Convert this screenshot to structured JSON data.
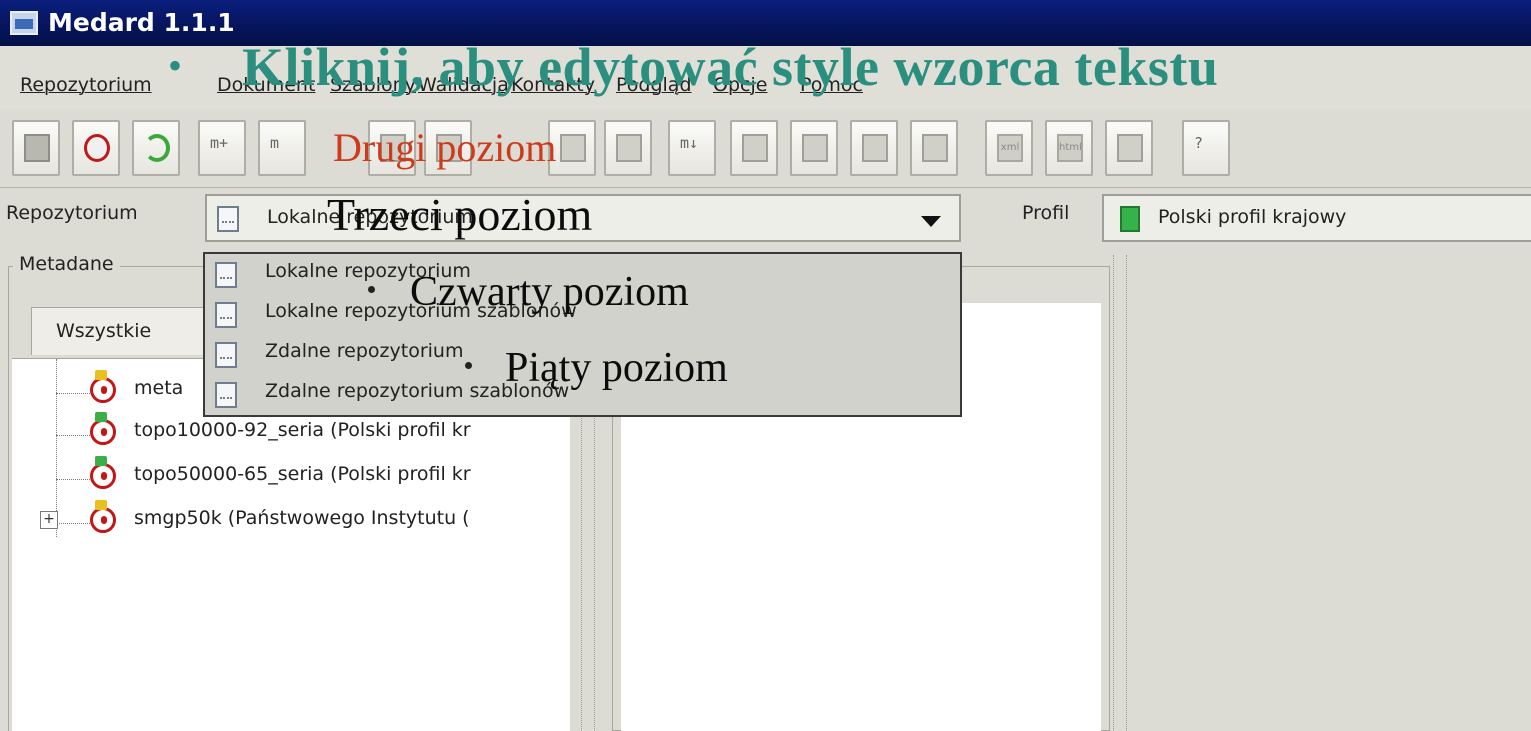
{
  "window": {
    "title": "Medard 1.1.1"
  },
  "menu": [
    "Repozytorium",
    "Dokument",
    "Szablony",
    "Walidacja",
    "Kontakty",
    "Podgląd",
    "Opcje",
    "Pomoc"
  ],
  "toolbar": {
    "buttons": [
      {
        "name": "upload-icon",
        "glyph": "grey"
      },
      {
        "name": "record-icon",
        "glyph": "red"
      },
      {
        "name": "refresh-icon",
        "glyph": "green"
      },
      {
        "name": "add-metadata-icon",
        "glyph": "m+"
      },
      {
        "name": "metadata-icon",
        "glyph": "m"
      },
      {
        "name": "edit-icon",
        "glyph": "doc"
      },
      {
        "name": "undo-icon",
        "glyph": "doc"
      },
      {
        "name": "hand-icon",
        "glyph": "doc"
      },
      {
        "name": "hand2-icon",
        "glyph": "doc"
      },
      {
        "name": "metadata-down-icon",
        "glyph": "m↓"
      },
      {
        "name": "validate-1-icon",
        "glyph": "doc"
      },
      {
        "name": "validate-2-icon",
        "glyph": "doc"
      },
      {
        "name": "validate-3-icon",
        "glyph": "doc"
      },
      {
        "name": "validate-4-icon",
        "glyph": "doc"
      },
      {
        "name": "xml-export-icon",
        "glyph": "xml"
      },
      {
        "name": "html-export-icon",
        "glyph": "html"
      },
      {
        "name": "print-icon",
        "glyph": "doc"
      },
      {
        "name": "help-icon",
        "glyph": "?"
      }
    ]
  },
  "repo": {
    "label": "Repozytorium",
    "selected": "Lokalne repozytorium",
    "options": [
      "Lokalne repozytorium",
      "Lokalne repozytorium szablonów",
      "Zdalne repozytorium",
      "Zdalne repozytorium szablonów"
    ]
  },
  "profile": {
    "label": "Profil",
    "value": "Polski profil krajowy"
  },
  "metadata": {
    "legend": "Metadane",
    "tab": "Wszystkie",
    "tree": [
      {
        "text": "meta",
        "icon": "yellow",
        "expandable": false
      },
      {
        "text": "topo10000-92_seria (Polski profil kr",
        "icon": "green",
        "expandable": false
      },
      {
        "text": "topo50000-65_seria (Polski profil kr",
        "icon": "green",
        "expandable": false
      },
      {
        "text": "smgp50k (Państwowego Instytutu (",
        "icon": "yellow",
        "expandable": true
      }
    ]
  },
  "overlay": {
    "level1": "Kliknij, aby edytować style wzorca tekstu",
    "level2": "Drugi poziom",
    "level3": "Trzeci poziom",
    "level4": "Czwarty poziom",
    "level5": "Piąty poziom"
  }
}
